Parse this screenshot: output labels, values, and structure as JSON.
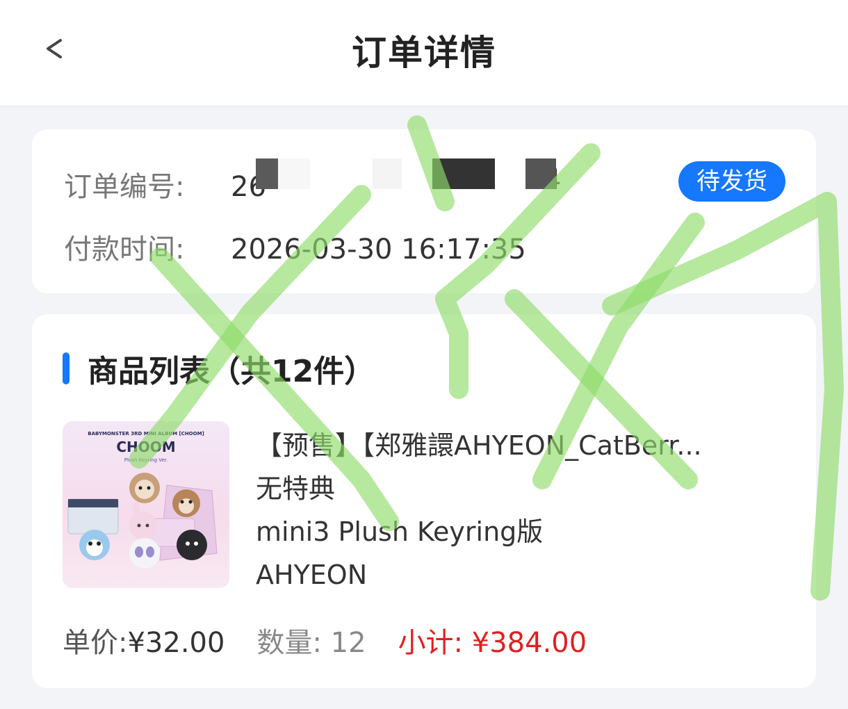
{
  "header": {
    "back_icon": "chevron-left-icon",
    "back_glyph": "<",
    "title": "订单详情"
  },
  "order": {
    "order_no_label": "订单编号:",
    "order_no_value": "26",
    "order_no_tail": "4",
    "pay_time_label": "付款时间:",
    "pay_time_value": "2026-03-30 16:17:35",
    "status": "待发货"
  },
  "goods": {
    "section_title": "商品列表（共12件）",
    "items": [
      {
        "name": "【预售】【郑雅譞AHYEON_CatBerr...",
        "line2": "无特典",
        "line3": "mini3 Plush Keyring版",
        "line4": "AHYEON",
        "image": {
          "header": "BABYMONSTER 3RD MINI ALBUM [CHOOM]",
          "title": "CHOOM",
          "subtitle": "Plush Keyring Ver."
        },
        "unit_price_label": "单价:",
        "unit_price": "¥32.00",
        "quantity_label": "数量:",
        "quantity": "12",
        "subtotal_label": "小计:",
        "subtotal": "¥384.00"
      }
    ]
  },
  "colors": {
    "accent": "#1677ff",
    "subtotal": "#e02020",
    "scribble": "#8fdc6a"
  }
}
